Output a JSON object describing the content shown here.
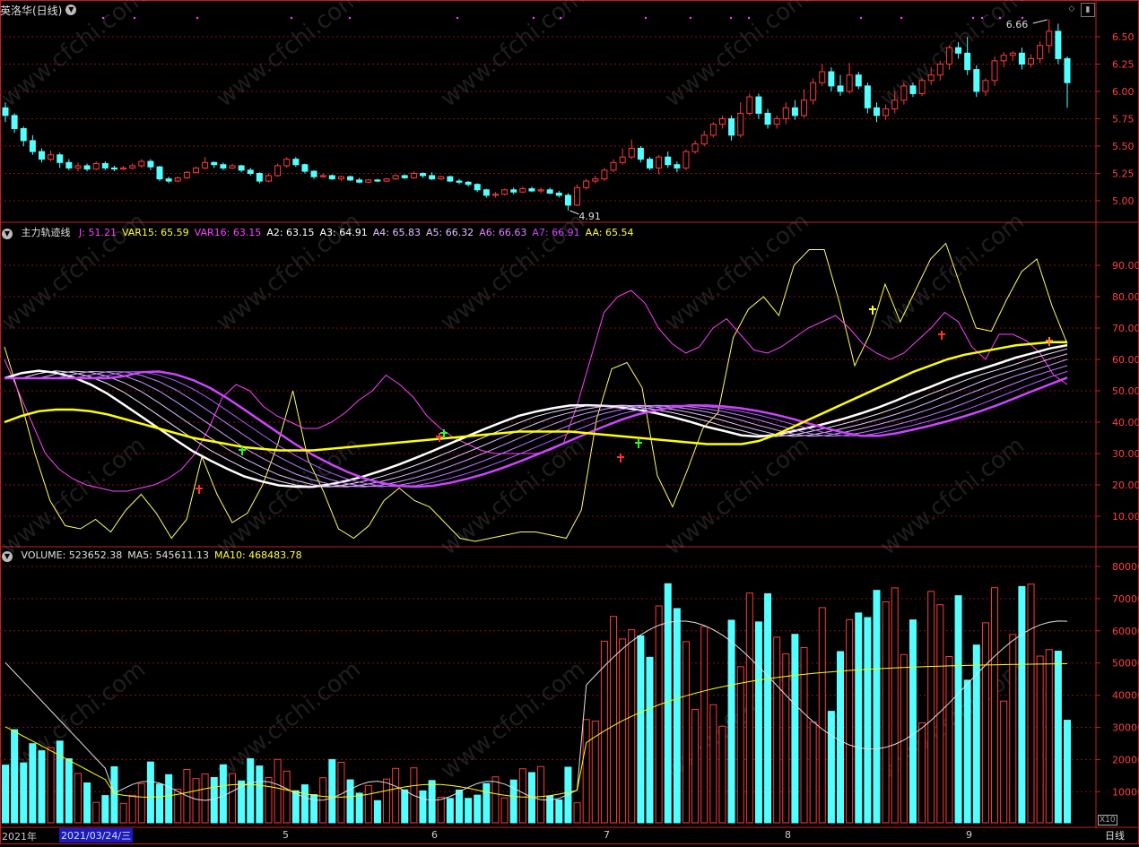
{
  "window": {
    "stock_name": "英洛华(日线)",
    "period_label": "日线",
    "x10_label": "X10"
  },
  "price_panel": {
    "high_label": "6.66",
    "low_label": "4.91",
    "y_ticks": [
      "6.50",
      "6.25",
      "6.00",
      "5.75",
      "5.50",
      "5.25",
      "5.00"
    ]
  },
  "indicator_panel": {
    "name": "主力轨迹线",
    "fields": [
      {
        "label": "J: 51.21",
        "color": "#ff40ff"
      },
      {
        "label": "VAR15: 65.59",
        "color": "#ffff40"
      },
      {
        "label": "VAR16: 63.15",
        "color": "#ff40ff"
      },
      {
        "label": "A2: 63.15",
        "color": "#ffffff"
      },
      {
        "label": "A3: 64.91",
        "color": "#ffffff"
      },
      {
        "label": "A4: 65.83",
        "color": "#e0c0ff"
      },
      {
        "label": "A5: 66.32",
        "color": "#e0c0ff"
      },
      {
        "label": "A6: 66.63",
        "color": "#e080ff"
      },
      {
        "label": "A7: 66.91",
        "color": "#cc44ff"
      },
      {
        "label": "AA: 65.54",
        "color": "#ffff40"
      }
    ],
    "y_ticks": [
      "90.00",
      "80.00",
      "70.00",
      "60.00",
      "50.00",
      "40.00",
      "30.00",
      "20.00",
      "10.00"
    ]
  },
  "volume_panel": {
    "fields": [
      {
        "label": "VOLUME: 523652.38",
        "color": "#e0e0e0"
      },
      {
        "label": "MA5: 545611.13",
        "color": "#e0e0e0"
      },
      {
        "label": "MA10: 468483.78",
        "color": "#ffff40"
      }
    ],
    "y_ticks": [
      "80000",
      "70000",
      "60000",
      "50000",
      "40000",
      "30000",
      "20000",
      "10000"
    ]
  },
  "date_axis": {
    "year_label": "2021年",
    "selected_date": "2021/03/24/三",
    "month_labels": [
      "5",
      "6",
      "7",
      "8",
      "9"
    ]
  },
  "watermark": "www.cfchi.com",
  "colors": {
    "up": "#ff3a3a",
    "down": "#54ffff",
    "grid": "#8a1010",
    "frame": "#c02020",
    "aa_line": "#ffff00",
    "j_line": "#ff40ff",
    "var_line": "#ffff60"
  },
  "chart_data": {
    "type": "candlestick",
    "candles": [
      [
        5.85,
        5.78,
        5.9,
        5.72
      ],
      [
        5.78,
        5.66,
        5.8,
        5.62
      ],
      [
        5.66,
        5.55,
        5.68,
        5.5
      ],
      [
        5.55,
        5.45,
        5.6,
        5.42
      ],
      [
        5.45,
        5.38,
        5.48,
        5.35
      ],
      [
        5.38,
        5.42,
        5.46,
        5.36
      ],
      [
        5.42,
        5.35,
        5.44,
        5.3
      ],
      [
        5.35,
        5.3,
        5.38,
        5.28
      ],
      [
        5.3,
        5.32,
        5.35,
        5.27
      ],
      [
        5.32,
        5.29,
        5.34,
        5.27
      ],
      [
        5.29,
        5.34,
        5.36,
        5.28
      ],
      [
        5.34,
        5.3,
        5.36,
        5.28
      ],
      [
        5.3,
        5.29,
        5.32,
        5.27
      ],
      [
        5.29,
        5.3,
        5.32,
        5.28
      ],
      [
        5.3,
        5.32,
        5.34,
        5.29
      ],
      [
        5.32,
        5.36,
        5.38,
        5.3
      ],
      [
        5.36,
        5.31,
        5.38,
        5.28
      ],
      [
        5.31,
        5.2,
        5.32,
        5.18
      ],
      [
        5.2,
        5.18,
        5.22,
        5.16
      ],
      [
        5.18,
        5.21,
        5.22,
        5.17
      ],
      [
        5.21,
        5.26,
        5.27,
        5.2
      ],
      [
        5.26,
        5.3,
        5.31,
        5.25
      ],
      [
        5.3,
        5.35,
        5.4,
        5.29
      ],
      [
        5.35,
        5.33,
        5.36,
        5.3
      ],
      [
        5.33,
        5.3,
        5.35,
        5.28
      ],
      [
        5.3,
        5.32,
        5.34,
        5.29
      ],
      [
        5.32,
        5.28,
        5.33,
        5.26
      ],
      [
        5.28,
        5.25,
        5.3,
        5.23
      ],
      [
        5.25,
        5.18,
        5.26,
        5.16
      ],
      [
        5.18,
        5.23,
        5.25,
        5.17
      ],
      [
        5.23,
        5.32,
        5.34,
        5.22
      ],
      [
        5.32,
        5.38,
        5.4,
        5.3
      ],
      [
        5.38,
        5.33,
        5.4,
        5.31
      ],
      [
        5.33,
        5.27,
        5.34,
        5.25
      ],
      [
        5.27,
        5.22,
        5.28,
        5.2
      ],
      [
        5.22,
        5.23,
        5.25,
        5.21
      ],
      [
        5.23,
        5.2,
        5.24,
        5.19
      ],
      [
        5.2,
        5.22,
        5.23,
        5.18
      ],
      [
        5.22,
        5.19,
        5.23,
        5.18
      ],
      [
        5.19,
        5.17,
        5.21,
        5.16
      ],
      [
        5.17,
        5.19,
        5.2,
        5.16
      ],
      [
        5.19,
        5.18,
        5.2,
        5.17
      ],
      [
        5.18,
        5.2,
        5.21,
        5.17
      ],
      [
        5.2,
        5.23,
        5.24,
        5.19
      ],
      [
        5.23,
        5.21,
        5.24,
        5.2
      ],
      [
        5.21,
        5.25,
        5.27,
        5.2
      ],
      [
        5.25,
        5.23,
        5.26,
        5.21
      ],
      [
        5.23,
        5.2,
        5.26,
        5.19
      ],
      [
        5.2,
        5.22,
        5.23,
        5.19
      ],
      [
        5.22,
        5.18,
        5.23,
        5.17
      ],
      [
        5.18,
        5.17,
        5.2,
        5.15
      ],
      [
        5.17,
        5.15,
        5.18,
        5.13
      ],
      [
        5.15,
        5.1,
        5.16,
        5.08
      ],
      [
        5.1,
        5.05,
        5.11,
        5.03
      ],
      [
        5.05,
        5.06,
        5.08,
        5.03
      ],
      [
        5.06,
        5.1,
        5.11,
        5.05
      ],
      [
        5.1,
        5.08,
        5.12,
        5.06
      ],
      [
        5.08,
        5.11,
        5.13,
        5.07
      ],
      [
        5.11,
        5.09,
        5.13,
        5.08
      ],
      [
        5.09,
        5.1,
        5.12,
        5.07
      ],
      [
        5.1,
        5.07,
        5.12,
        5.06
      ],
      [
        5.07,
        5.05,
        5.09,
        5.03
      ],
      [
        5.05,
        4.96,
        5.07,
        4.91
      ],
      [
        4.96,
        5.12,
        5.15,
        4.95
      ],
      [
        5.12,
        5.18,
        5.2,
        5.1
      ],
      [
        5.18,
        5.2,
        5.23,
        5.16
      ],
      [
        5.2,
        5.28,
        5.3,
        5.18
      ],
      [
        5.28,
        5.35,
        5.38,
        5.26
      ],
      [
        5.35,
        5.4,
        5.48,
        5.33
      ],
      [
        5.4,
        5.48,
        5.56,
        5.38
      ],
      [
        5.48,
        5.38,
        5.5,
        5.35
      ],
      [
        5.38,
        5.3,
        5.4,
        5.28
      ],
      [
        5.3,
        5.4,
        5.42,
        5.24
      ],
      [
        5.4,
        5.33,
        5.45,
        5.3
      ],
      [
        5.33,
        5.3,
        5.36,
        5.26
      ],
      [
        5.3,
        5.45,
        5.47,
        5.28
      ],
      [
        5.45,
        5.52,
        5.55,
        5.43
      ],
      [
        5.52,
        5.6,
        5.64,
        5.5
      ],
      [
        5.6,
        5.7,
        5.72,
        5.58
      ],
      [
        5.7,
        5.75,
        5.78,
        5.66
      ],
      [
        5.75,
        5.6,
        5.78,
        5.55
      ],
      [
        5.6,
        5.8,
        5.9,
        5.58
      ],
      [
        5.8,
        5.95,
        5.98,
        5.78
      ],
      [
        5.95,
        5.8,
        5.98,
        5.75
      ],
      [
        5.8,
        5.7,
        5.84,
        5.66
      ],
      [
        5.7,
        5.75,
        5.78,
        5.66
      ],
      [
        5.75,
        5.85,
        5.9,
        5.7
      ],
      [
        5.85,
        5.78,
        5.92,
        5.74
      ],
      [
        5.78,
        5.92,
        6.02,
        5.76
      ],
      [
        5.92,
        6.08,
        6.12,
        5.88
      ],
      [
        6.08,
        6.18,
        6.25,
        6.05
      ],
      [
        6.18,
        6.05,
        6.22,
        6.0
      ],
      [
        6.05,
        6.0,
        6.15,
        5.96
      ],
      [
        6.0,
        6.15,
        6.26,
        5.98
      ],
      [
        6.15,
        6.05,
        6.18,
        6.02
      ],
      [
        6.05,
        5.85,
        6.08,
        5.8
      ],
      [
        5.85,
        5.78,
        5.9,
        5.72
      ],
      [
        5.78,
        5.84,
        5.88,
        5.74
      ],
      [
        5.84,
        5.92,
        6.0,
        5.8
      ],
      [
        5.92,
        6.05,
        6.08,
        5.88
      ],
      [
        6.05,
        5.98,
        6.08,
        5.95
      ],
      [
        5.98,
        6.1,
        6.12,
        5.96
      ],
      [
        6.1,
        6.15,
        6.22,
        6.06
      ],
      [
        6.15,
        6.25,
        6.28,
        6.1
      ],
      [
        6.25,
        6.4,
        6.42,
        6.2
      ],
      [
        6.4,
        6.35,
        6.45,
        6.3
      ],
      [
        6.35,
        6.2,
        6.5,
        6.15
      ],
      [
        6.2,
        6.0,
        6.24,
        5.95
      ],
      [
        6.0,
        6.1,
        6.12,
        5.96
      ],
      [
        6.1,
        6.28,
        6.32,
        6.05
      ],
      [
        6.28,
        6.33,
        6.36,
        6.22
      ],
      [
        6.33,
        6.35,
        6.37,
        6.28
      ],
      [
        6.35,
        6.25,
        6.4,
        6.2
      ],
      [
        6.25,
        6.3,
        6.34,
        6.22
      ],
      [
        6.3,
        6.42,
        6.46,
        6.26
      ],
      [
        6.42,
        6.55,
        6.66,
        6.35
      ],
      [
        6.55,
        6.3,
        6.62,
        6.25
      ],
      [
        6.3,
        6.08,
        6.32,
        5.85
      ]
    ],
    "aa_line": [
      40,
      42,
      43.5,
      44,
      44,
      43.5,
      42.5,
      41,
      39.5,
      38,
      36.5,
      35,
      34,
      33,
      32,
      31.5,
      31,
      31,
      31,
      31.5,
      32,
      32.5,
      33,
      33.5,
      34,
      34.5,
      35,
      35.5,
      36,
      36.5,
      37,
      37,
      37,
      37,
      36.5,
      36,
      35.5,
      35,
      34.5,
      34,
      33.5,
      33,
      33,
      33,
      34,
      36,
      38.5,
      41,
      43.5,
      46,
      48.5,
      51,
      53.5,
      56,
      58,
      60,
      61.5,
      62.5,
      63.5,
      64.5,
      65,
      65.5,
      65.5
    ],
    "var15_line": [
      64,
      48,
      30,
      15,
      7,
      6,
      9,
      5,
      12,
      17,
      11,
      3,
      9,
      29,
      17,
      8,
      11,
      20,
      33,
      50,
      28,
      18,
      6,
      3,
      7,
      15,
      19,
      15,
      13,
      8,
      3,
      2,
      3,
      4,
      5,
      5,
      4,
      3,
      12,
      41,
      57,
      59,
      51,
      23,
      13,
      25,
      38,
      43,
      67,
      76,
      80,
      74,
      90,
      95,
      95,
      78,
      58,
      68,
      84,
      72,
      82,
      92,
      97,
      83,
      70,
      69,
      79,
      88,
      92,
      77,
      65
    ],
    "j_line": [
      60,
      50,
      40,
      30,
      25,
      22,
      20,
      19,
      18,
      18,
      19,
      20,
      22,
      25,
      30,
      38,
      48,
      52,
      50,
      45,
      42,
      40,
      38,
      38,
      40,
      43,
      47,
      50,
      55,
      52,
      48,
      42,
      38,
      35,
      33,
      31,
      30,
      30,
      30,
      30,
      31,
      33,
      45,
      60,
      75,
      80,
      82,
      78,
      70,
      65,
      62,
      64,
      70,
      73,
      68,
      63,
      62,
      64,
      67,
      70,
      72,
      74,
      70,
      65,
      62,
      60,
      62,
      66,
      70,
      75,
      72,
      64,
      60,
      68,
      68,
      66,
      62,
      55,
      52
    ]
  }
}
